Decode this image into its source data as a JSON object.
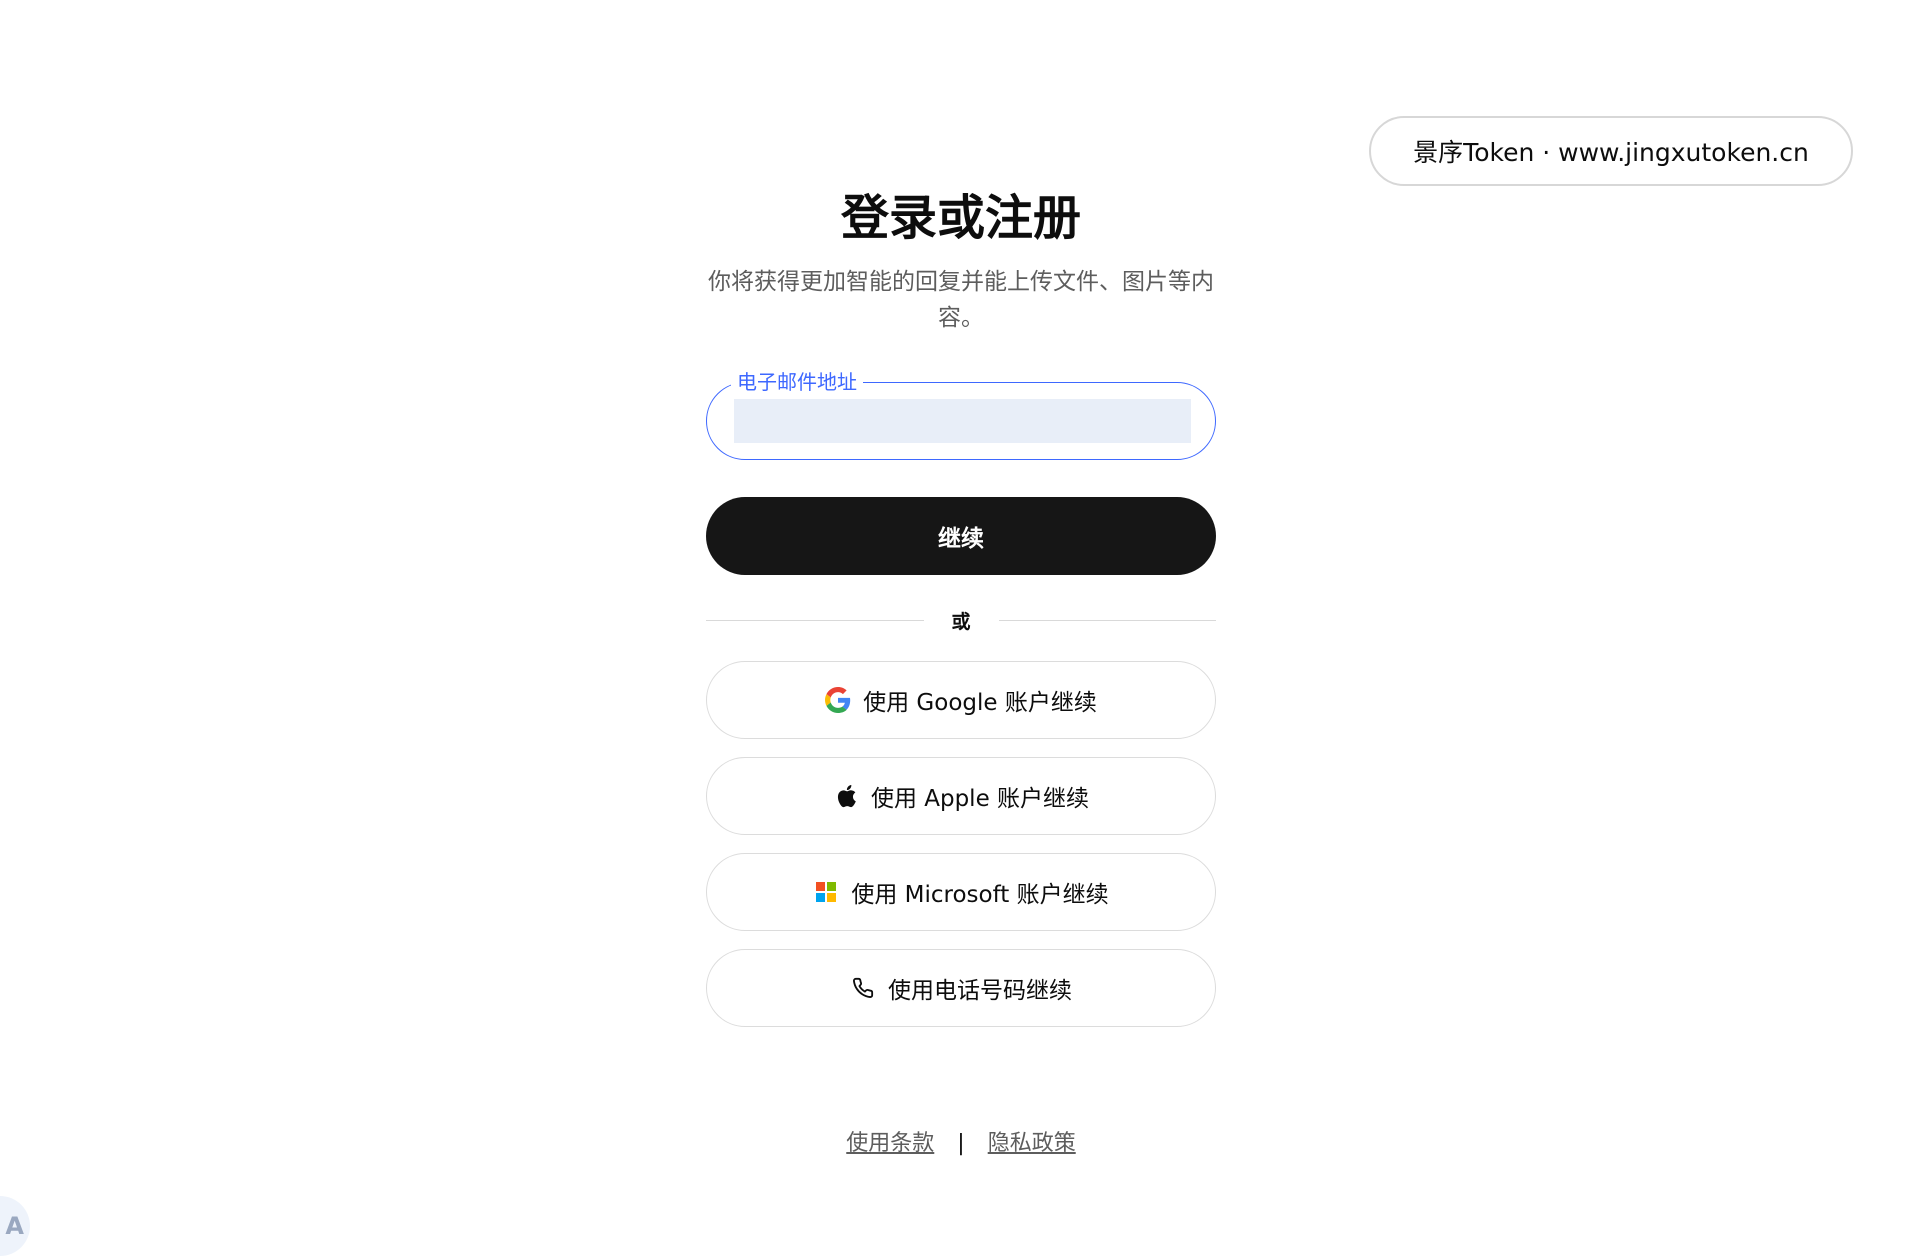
{
  "watermark": {
    "text": "景序Token · www.jingxutoken.cn"
  },
  "auth": {
    "title": "登录或注册",
    "subtitle": "你将获得更加智能的回复并能上传文件、图片等内容。",
    "email_label": "电子邮件地址",
    "email_value": "",
    "continue_label": "继续",
    "or_label": "或"
  },
  "social": {
    "google_label": "使用 Google 账户继续",
    "apple_label": "使用 Apple 账户继续",
    "microsoft_label": "使用 Microsoft 账户继续",
    "phone_label": "使用电话号码继续"
  },
  "footer": {
    "terms": "使用条款",
    "separator": "|",
    "privacy": "隐私政策"
  },
  "icons": {
    "google": "google-icon",
    "apple": "apple-icon",
    "microsoft": "microsoft-icon",
    "phone": "phone-icon",
    "translate": "translate-icon"
  },
  "colors": {
    "accent": "#3e68ff",
    "primary_button": "#161616",
    "input_fill": "#e8eef8"
  }
}
